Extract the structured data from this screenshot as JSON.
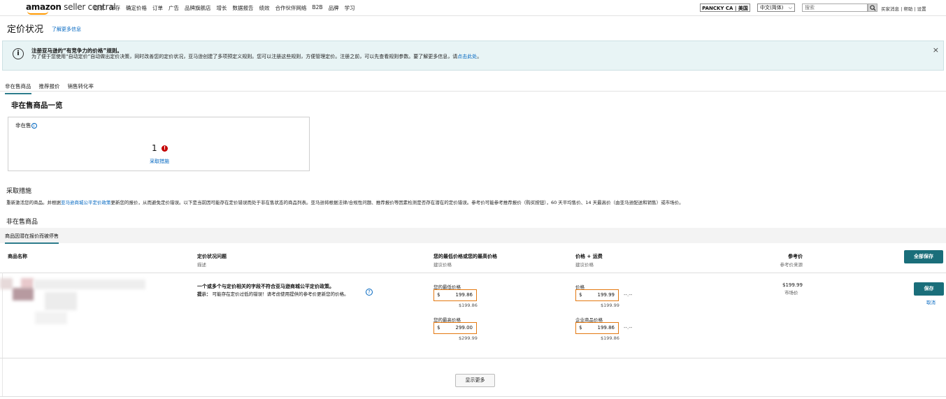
{
  "topnav": {
    "logo_amazon": "amazon",
    "logo_rest": " seller central",
    "menu": [
      "目录",
      "库存",
      "确定价格",
      "订单",
      "广告",
      "品牌旗舰店",
      "增长",
      "数据报告",
      "绩效",
      "合作伙伴网络",
      "B2B",
      "品牌",
      "学习"
    ],
    "store": "PANCKY CA | 美国",
    "language": "中文(简体)",
    "search_placeholder": "搜索",
    "links": "买家消息 | 帮助 | 设置"
  },
  "page": {
    "title": "定价状况",
    "learn_more": "了解更多信息"
  },
  "banner": {
    "title": "注册亚马逊的“有竞争力的价格”规则。",
    "text_before": "为了便于您使用“自动定价”自动做出定价决策，同时改善您的定价状况，亚马逊创建了多项预定义规则。您可以注册这些规则，方便管理定价。注册之前，可以先查看规则参数。要了解更多信息，请",
    "text_link": "点击此处",
    "text_after": "。",
    "close": "×"
  },
  "tabs": [
    "非在售商品",
    "推荐报价",
    "销售转化率"
  ],
  "list_title": "非在售商品一览",
  "card": {
    "label": "非在售",
    "count": "1",
    "action": "采取措施"
  },
  "action_section": {
    "heading": "采取措施",
    "text_before": "重新激活您的商品。并根据",
    "text_link": "亚马逊商城公平定价政策",
    "text_after": "更新您的报价，从而避免定价错误。以下是当前因可能存在定价错误而处于非在售状态的商品列表。亚马逊将根据法律/合规性问题、推荐报价等因素检测是否存在潜在的定价错误。参考价可能参考推荐报价（购买按钮），60 天平均售价、14 天最高价（由亚马逊配送和销售）或市场价。"
  },
  "inactive_heading": "非在售商品",
  "subtab": "商品因潜在报价而被停售",
  "table": {
    "col_name": "商品名称",
    "col_issue": "定价状况问题",
    "col_issue_sub": "描述",
    "col_minmax": "您的最低价格或您的最高价格",
    "col_minmax_sub": "建议价格",
    "col_price": "价格 + 运费",
    "col_price_sub": "建议价格",
    "col_ref": "参考价",
    "col_ref_sub": "参考价来源",
    "save_all": "全部保存"
  },
  "row": {
    "issue": "一个或多个与定价相关的字段不符合亚马逊商城公平定价政策。",
    "hint_label": "提示：",
    "hint_text": "可能存在定价过低的错误！请考虑使用提供的参考价更新您的价格。",
    "help": "?",
    "min_label": "您的最低价格",
    "min_currency": "$",
    "min_value": "199.86",
    "min_suggest": "$199.86",
    "max_label": "您的最高价格",
    "max_currency": "$",
    "max_value": "299.00",
    "max_suggest": "$299.99",
    "price_label": "价格",
    "price_currency": "$",
    "price_value": "199.99",
    "price_suggest": "$199.99",
    "price_dash": "--.--",
    "biz_label": "企业商品价格",
    "biz_currency": "$",
    "biz_value": "199.86",
    "biz_suggest": "$199.86",
    "biz_dash": "--.--",
    "ref_price": "$199.99",
    "ref_source": "市场价",
    "save": "保存",
    "cancel": "取消"
  },
  "show_more": "显示更多",
  "colors": {
    "accent": "#1a6e7a",
    "highlight": "#e47911",
    "link": "#0066c0",
    "alert": "#c40000"
  }
}
